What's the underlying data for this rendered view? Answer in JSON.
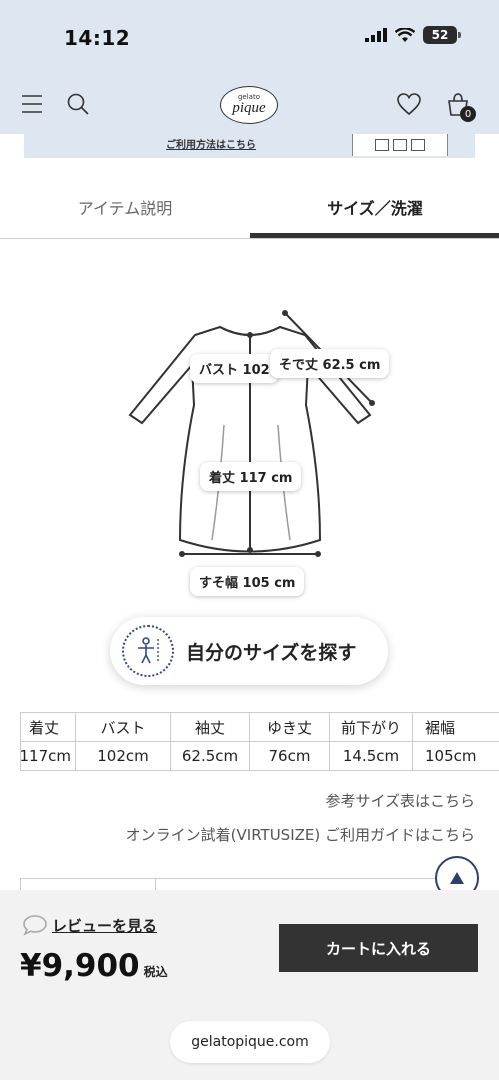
{
  "status_bar": {
    "time": "14:12",
    "battery": "52"
  },
  "header": {
    "logo_small": "gelato",
    "logo_main": "pique",
    "cart_count": "0"
  },
  "banner": {
    "link_text": "ご利用方法はこちら"
  },
  "tabs": [
    {
      "label": "アイテム説明",
      "active": false
    },
    {
      "label": "サイズ／洗濯",
      "active": true
    }
  ],
  "diagram": {
    "bust_label": "バスト 102",
    "sleeve_label": "そで丈 62.5 cm",
    "length_label": "着丈 117 cm",
    "hem_label": "すそ幅 105 cm"
  },
  "find_size": {
    "label": "自分のサイズを探す"
  },
  "size_table": {
    "headers": [
      "着丈",
      "バスト",
      "袖丈",
      "ゆき丈",
      "前下がり",
      "裾幅"
    ],
    "values": [
      "117cm",
      "102cm",
      "62.5cm",
      "76cm",
      "14.5cm",
      "105cm"
    ]
  },
  "links": {
    "reference": "参考サイズ表はこちら",
    "virtusize": "オンライン試着(VIRTUSIZE) ご利用ガイドはこちら"
  },
  "bottom": {
    "review_label": "レビューを見る",
    "price": "¥9,900",
    "tax_label": "税込",
    "cart_button": "カートに入れる",
    "url": "gelatopique.com"
  },
  "colors": {
    "header_bg": "#dde6f1",
    "cart_button": "#333333",
    "accent_navy": "#2b4070"
  }
}
